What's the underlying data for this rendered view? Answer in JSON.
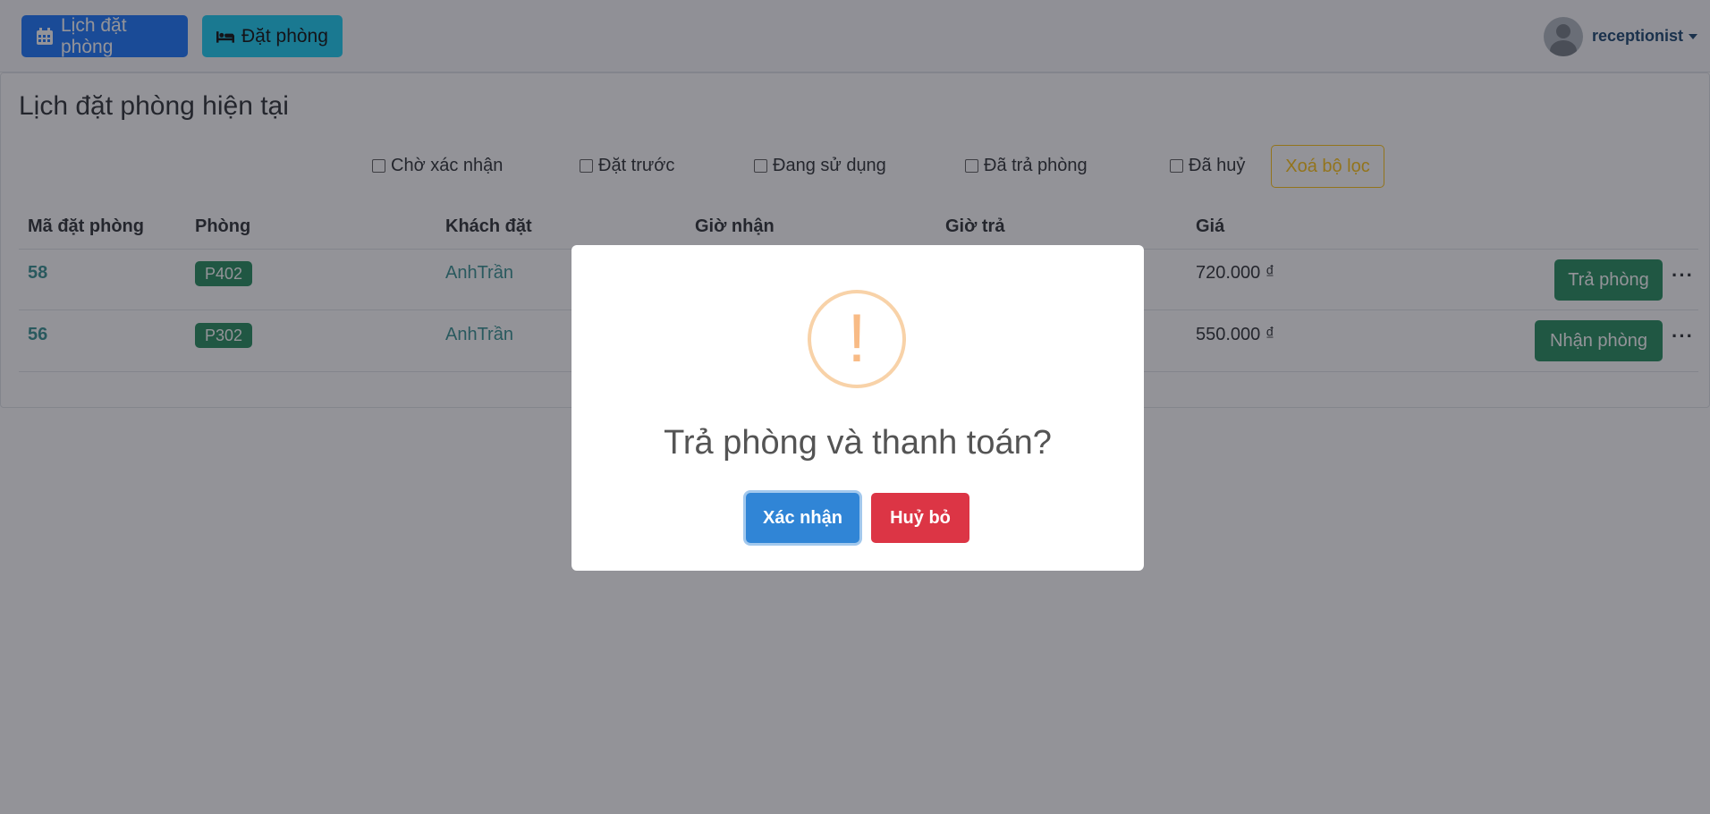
{
  "navbar": {
    "schedule_button": "Lịch đặt phòng",
    "booking_button": "Đặt phòng",
    "user_name": "receptionist"
  },
  "page": {
    "title": "Lịch đặt phòng hiện tại"
  },
  "filters": [
    {
      "label": "Chờ xác nhận",
      "checked": false
    },
    {
      "label": "Đặt trước",
      "checked": false
    },
    {
      "label": "Đang sử dụng",
      "checked": false
    },
    {
      "label": "Đã trả phòng",
      "checked": false
    },
    {
      "label": "Đã huỷ",
      "checked": false
    }
  ],
  "clear_filter_label": "Xoá bộ lọc",
  "table": {
    "headers": [
      "Mã đặt phòng",
      "Phòng",
      "Khách đặt",
      "Giờ nhận",
      "Giờ trả",
      "Giá"
    ],
    "rows": [
      {
        "id": "58",
        "room": "P402",
        "guest": "AnhTrần",
        "price": "720.000 ₫",
        "action": "Trả phòng"
      },
      {
        "id": "56",
        "room": "P302",
        "guest": "AnhTrần",
        "price": "550.000 ₫",
        "action": "Nhận phòng"
      }
    ]
  },
  "dialog": {
    "icon": "!",
    "title": "Trả phòng và thanh toán?",
    "confirm": "Xác nhận",
    "cancel": "Huỷ bỏ"
  },
  "colors": {
    "primary": "#0d6efd",
    "info": "#0dcaf0",
    "success": "#198754",
    "warning": "#ffc107",
    "confirm": "#3085d6",
    "cancel": "#dc3545"
  }
}
